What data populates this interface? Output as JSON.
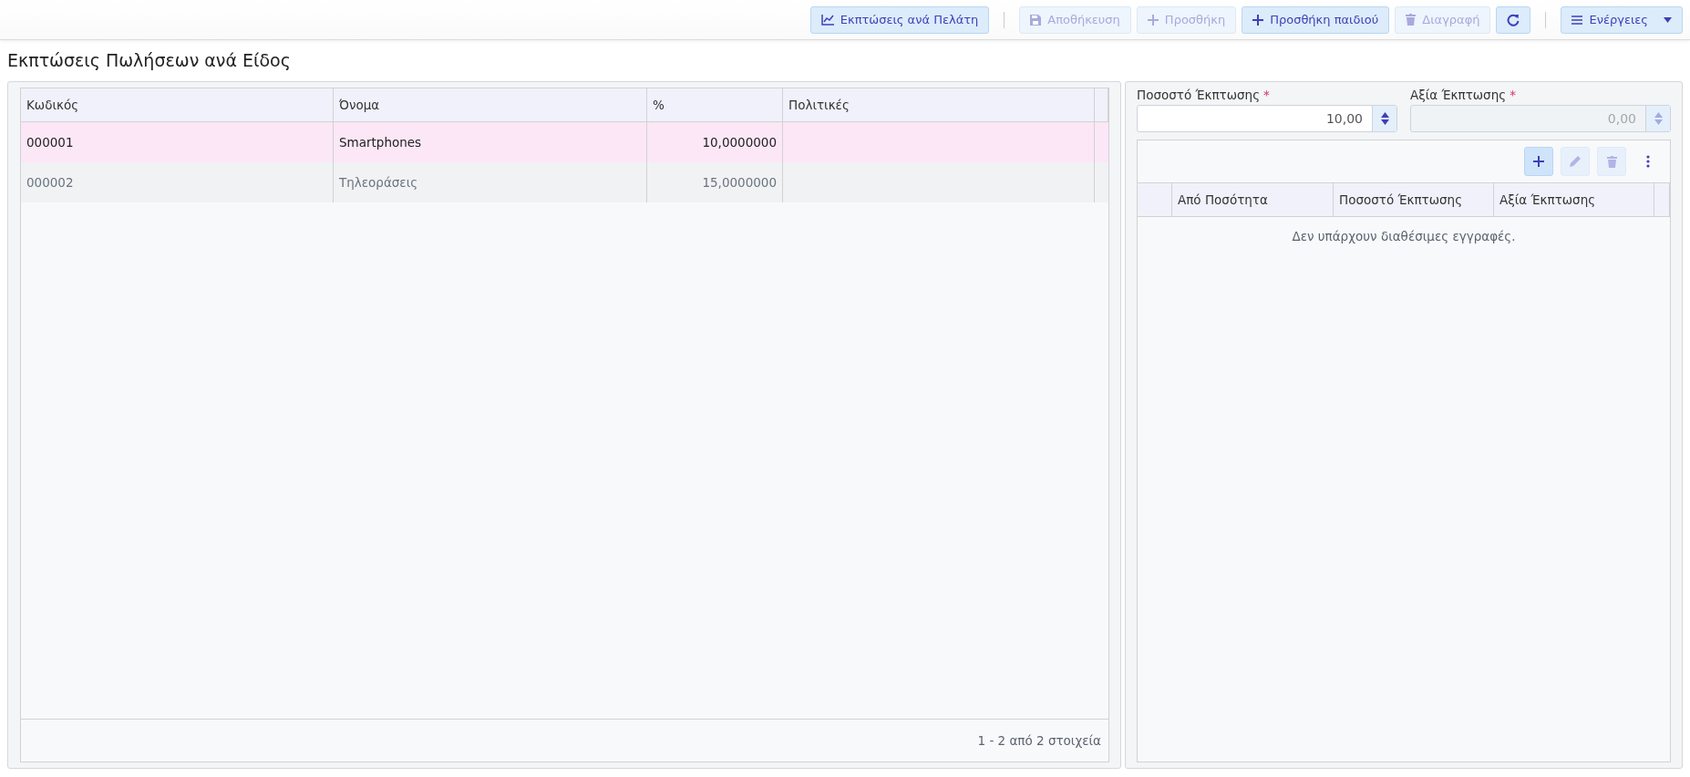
{
  "toolbar": [
    {
      "kind": "chart",
      "label": "Εκπτώσεις ανά Πελάτη",
      "disabled": false
    },
    {
      "kind": "separator"
    },
    {
      "kind": "save",
      "label": "Αποθήκευση",
      "disabled": true
    },
    {
      "kind": "add",
      "label": "Προσθήκη",
      "disabled": true
    },
    {
      "kind": "add",
      "label": "Προσθήκη παιδιού",
      "disabled": false
    },
    {
      "kind": "delete",
      "label": "Διαγραφή",
      "disabled": true
    },
    {
      "kind": "refresh",
      "disabled": false
    },
    {
      "kind": "separator"
    },
    {
      "kind": "menu",
      "label": "Ενέργειες",
      "disabled": false
    }
  ],
  "page_title": "Εκπτώσεις Πωλήσεων ανά Είδος",
  "table": {
    "columns": [
      "Κωδικός",
      "Όνομα",
      "%",
      "Πολιτικές"
    ],
    "rows": [
      {
        "cells": [
          "000001",
          "Smartphones",
          "10,0000000",
          ""
        ],
        "selected": true
      },
      {
        "cells": [
          "000002",
          "Τηλεοράσεις",
          "15,0000000",
          ""
        ],
        "selected": false
      }
    ],
    "footer": "1 - 2 από 2 στοιχεία"
  },
  "fields": [
    {
      "label": "Ποσοστό Έκπτωσης",
      "required_mark": "*",
      "value": "10,00",
      "disabled": false
    },
    {
      "label": "Αξία Έκπτωσης",
      "required_mark": "*",
      "value": "0,00",
      "disabled": true
    }
  ],
  "detail": {
    "toolbar": [
      {
        "kind": "add",
        "disabled": false
      },
      {
        "kind": "edit",
        "disabled": true
      },
      {
        "kind": "delete",
        "disabled": true
      },
      {
        "kind": "more",
        "disabled": false
      }
    ],
    "columns": [
      "",
      "Από Ποσότητα",
      "Ποσοστό Έκπτωσης",
      "Αξία Έκπτωσης"
    ],
    "empty_message": "Δεν υπάρχουν διαθέσιμες εγγραφές."
  }
}
